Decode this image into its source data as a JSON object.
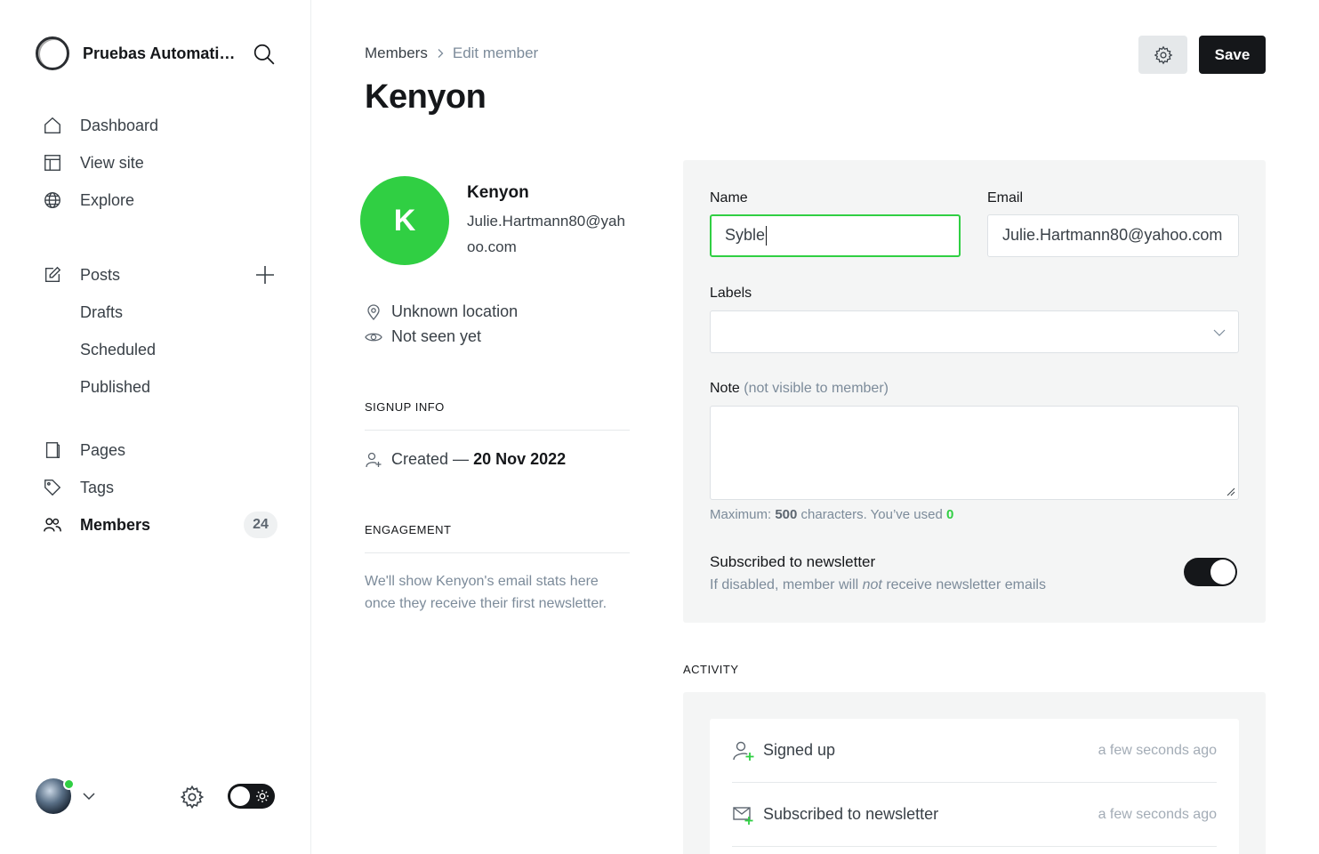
{
  "sidebar": {
    "brand": "Pruebas Automatizadas",
    "nav_main": [
      {
        "label": "Dashboard",
        "icon": "home-icon"
      },
      {
        "label": "View site",
        "icon": "layout-icon"
      },
      {
        "label": "Explore",
        "icon": "globe-icon"
      }
    ],
    "posts": {
      "label": "Posts",
      "icon": "edit-icon"
    },
    "posts_sub": [
      "Drafts",
      "Scheduled",
      "Published"
    ],
    "pages": {
      "label": "Pages",
      "icon": "pages-icon"
    },
    "tags": {
      "label": "Tags",
      "icon": "tag-icon"
    },
    "members": {
      "label": "Members",
      "icon": "members-icon",
      "count": "24"
    }
  },
  "header": {
    "breadcrumb_parent": "Members",
    "breadcrumb_current": "Edit member",
    "title": "Kenyon",
    "save_label": "Save"
  },
  "member": {
    "initial": "K",
    "name": "Kenyon",
    "email": "Julie.Hartmann80@yahoo.com",
    "location": "Unknown location",
    "seen": "Not seen yet",
    "signup_heading": "SIGNUP INFO",
    "created_prefix": "Created —",
    "created_date": "20 Nov 2022",
    "engagement_heading": "ENGAGEMENT",
    "engagement_text": "We'll show Kenyon's email stats here once they receive their first newsletter."
  },
  "form": {
    "name_label": "Name",
    "name_value": "Syble",
    "email_label": "Email",
    "email_value": "Julie.Hartmann80@yahoo.com",
    "labels_label": "Labels",
    "note_label": "Note",
    "note_muted": "(not visible to member)",
    "hint_prefix": "Maximum:",
    "hint_max": "500",
    "hint_mid": "characters. You’ve used",
    "hint_used": "0",
    "newsletter_title": "Subscribed to newsletter",
    "newsletter_sub_a": "If disabled, member will",
    "newsletter_sub_em": "not",
    "newsletter_sub_b": "receive newsletter emails",
    "newsletter_on": true
  },
  "activity": {
    "heading": "ACTIVITY",
    "items": [
      {
        "text": "Signed up",
        "time": "a few seconds ago",
        "icon": "user-add-icon"
      },
      {
        "text": "Subscribed to newsletter",
        "time": "a few seconds ago",
        "icon": "mail-add-icon"
      }
    ]
  },
  "colors": {
    "accent": "#30cf43",
    "dark": "#15171a",
    "muted": "#7c8b9a"
  }
}
